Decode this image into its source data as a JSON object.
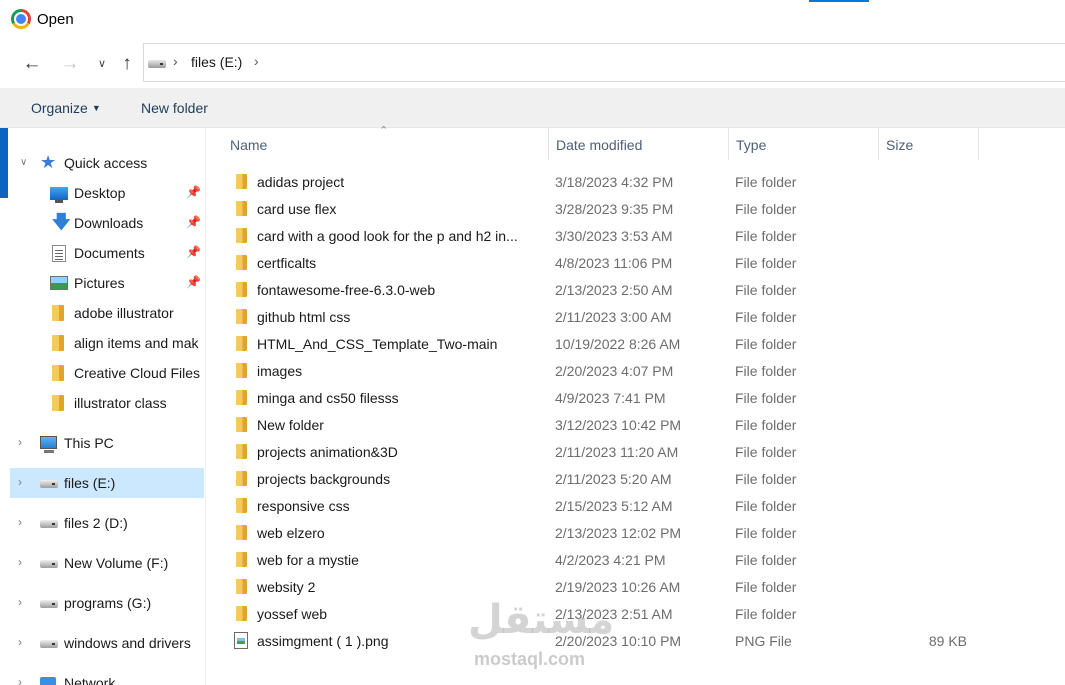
{
  "window": {
    "title": "Open",
    "accent_color": "#0078d7"
  },
  "navigation": {
    "back_icon": "arrow-left-icon",
    "forward_icon": "arrow-right-icon",
    "recent_icon": "chevron-down-icon",
    "up_icon": "arrow-up-icon",
    "address": {
      "drive_icon": "drive-icon",
      "segment": "files (E:)"
    }
  },
  "toolbar": {
    "organize_label": "Organize",
    "new_folder_label": "New folder"
  },
  "sidebar": {
    "selected_color": "#cce8ff",
    "quick_access": {
      "label": "Quick access",
      "icon": "star-icon",
      "items": [
        {
          "label": "Desktop",
          "icon": "desktop-icon",
          "pinned": true
        },
        {
          "label": "Downloads",
          "icon": "download-icon",
          "pinned": true
        },
        {
          "label": "Documents",
          "icon": "document-icon",
          "pinned": true
        },
        {
          "label": "Pictures",
          "icon": "pictures-icon",
          "pinned": true
        },
        {
          "label": "adobe illustrator",
          "icon": "folder-icon",
          "pinned": false
        },
        {
          "label": "align items and mak",
          "icon": "folder-icon",
          "pinned": false
        },
        {
          "label": "Creative Cloud Files",
          "icon": "folder-icon",
          "pinned": false
        },
        {
          "label": "illustrator class",
          "icon": "folder-icon",
          "pinned": false
        }
      ]
    },
    "locations": [
      {
        "label": "This PC",
        "icon": "computer-icon",
        "selected": false
      },
      {
        "label": "files (E:)",
        "icon": "drive-icon",
        "selected": true
      },
      {
        "label": "files 2 (D:)",
        "icon": "drive-icon",
        "selected": false
      },
      {
        "label": "New Volume (F:)",
        "icon": "drive-icon",
        "selected": false
      },
      {
        "label": "programs (G:)",
        "icon": "drive-icon",
        "selected": false
      },
      {
        "label": "windows and drivers",
        "icon": "drive-icon",
        "selected": false
      },
      {
        "label": "Network",
        "icon": "network-icon",
        "selected": false
      }
    ]
  },
  "file_list": {
    "columns": [
      "Name",
      "Date modified",
      "Type",
      "Size"
    ],
    "rows": [
      {
        "name": "adidas project",
        "date": "3/18/2023 4:32 PM",
        "type": "File folder",
        "size": "",
        "icon": "folder-icon"
      },
      {
        "name": "card use flex",
        "date": "3/28/2023 9:35 PM",
        "type": "File folder",
        "size": "",
        "icon": "folder-icon"
      },
      {
        "name": "card with a good look for the p and h2 in...",
        "date": "3/30/2023 3:53 AM",
        "type": "File folder",
        "size": "",
        "icon": "folder-icon"
      },
      {
        "name": "certficalts",
        "date": "4/8/2023 11:06 PM",
        "type": "File folder",
        "size": "",
        "icon": "folder-icon"
      },
      {
        "name": "fontawesome-free-6.3.0-web",
        "date": "2/13/2023 2:50 AM",
        "type": "File folder",
        "size": "",
        "icon": "folder-icon"
      },
      {
        "name": "github html css",
        "date": "2/11/2023 3:00 AM",
        "type": "File folder",
        "size": "",
        "icon": "folder-icon"
      },
      {
        "name": "HTML_And_CSS_Template_Two-main",
        "date": "10/19/2022 8:26 AM",
        "type": "File folder",
        "size": "",
        "icon": "folder-icon"
      },
      {
        "name": "images",
        "date": "2/20/2023 4:07 PM",
        "type": "File folder",
        "size": "",
        "icon": "folder-icon"
      },
      {
        "name": "minga and cs50 filesss",
        "date": "4/9/2023 7:41 PM",
        "type": "File folder",
        "size": "",
        "icon": "folder-icon"
      },
      {
        "name": "New folder",
        "date": "3/12/2023 10:42 PM",
        "type": "File folder",
        "size": "",
        "icon": "folder-icon"
      },
      {
        "name": "projects animation&3D",
        "date": "2/11/2023 11:20 AM",
        "type": "File folder",
        "size": "",
        "icon": "folder-icon"
      },
      {
        "name": "projects backgrounds",
        "date": "2/11/2023 5:20 AM",
        "type": "File folder",
        "size": "",
        "icon": "folder-icon"
      },
      {
        "name": "responsive css",
        "date": "2/15/2023 5:12 AM",
        "type": "File folder",
        "size": "",
        "icon": "folder-icon"
      },
      {
        "name": "web elzero",
        "date": "2/13/2023 12:02 PM",
        "type": "File folder",
        "size": "",
        "icon": "folder-icon"
      },
      {
        "name": "web for a mystie",
        "date": "4/2/2023 4:21 PM",
        "type": "File folder",
        "size": "",
        "icon": "folder-icon"
      },
      {
        "name": "websity 2",
        "date": "2/19/2023 10:26 AM",
        "type": "File folder",
        "size": "",
        "icon": "folder-icon"
      },
      {
        "name": "yossef web",
        "date": "2/13/2023 2:51 AM",
        "type": "File folder",
        "size": "",
        "icon": "folder-icon"
      },
      {
        "name": "assimgment ( 1 ).png",
        "date": "2/20/2023 10:10 PM",
        "type": "PNG File",
        "size": "89 KB",
        "icon": "png-file-icon"
      }
    ]
  },
  "watermark": {
    "logo_text": "مستقل",
    "text": "mostaql.com"
  }
}
